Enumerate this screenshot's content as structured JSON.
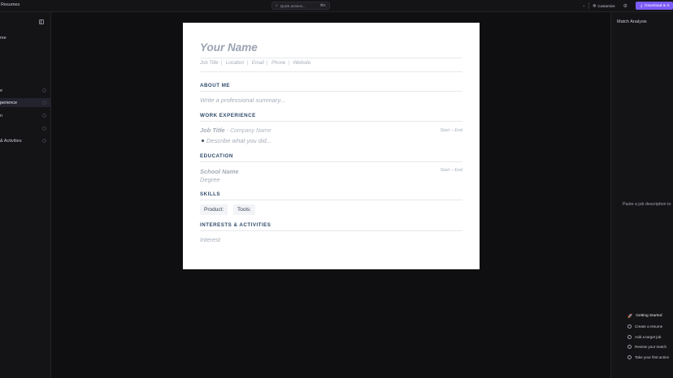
{
  "topbar": {
    "breadcrumb": "Resumes",
    "quick_actions_placeholder": "Quick actions...",
    "quick_actions_shortcut": "⌘K",
    "customize_label": "Customize",
    "download_label": "Download & S"
  },
  "sidebar": {
    "resume_name": "me",
    "items": [
      {
        "label": "e"
      },
      {
        "label": "perience"
      },
      {
        "label": "n"
      },
      {
        "label": ""
      },
      {
        "label": "& Activities"
      }
    ]
  },
  "resume": {
    "name_placeholder": "Your Name",
    "contact": [
      "Job Title",
      "Location",
      "Email",
      "Phone",
      "Website"
    ],
    "about_heading": "ABOUT ME",
    "about_placeholder": "Write a professional summary...",
    "work_heading": "WORK EXPERIENCE",
    "work_job_title": "Job Title",
    "work_company": "- Company Name",
    "work_dates": "Start – End",
    "work_bullet": "Describe what you did...",
    "education_heading": "EDUCATION",
    "school_name": "School Name",
    "degree": "Degree",
    "edu_dates": "Start – End",
    "skills_heading": "SKILLS",
    "skills": [
      "Product:",
      "Tools:"
    ],
    "interests_heading": "INTERESTS & ACTIVITIES",
    "interest_placeholder": "Interest"
  },
  "right_panel": {
    "title": "Match Analysis",
    "paste_prompt": "Paste a job description to",
    "getting_started": {
      "title": "Getting Started",
      "steps": [
        "Create a resume",
        "Add a target job",
        "Review your match",
        "Take your first action"
      ]
    }
  },
  "colors": {
    "accent": "#7c5cf5",
    "heading": "#2f4a6b",
    "background": "#0f0f11"
  }
}
